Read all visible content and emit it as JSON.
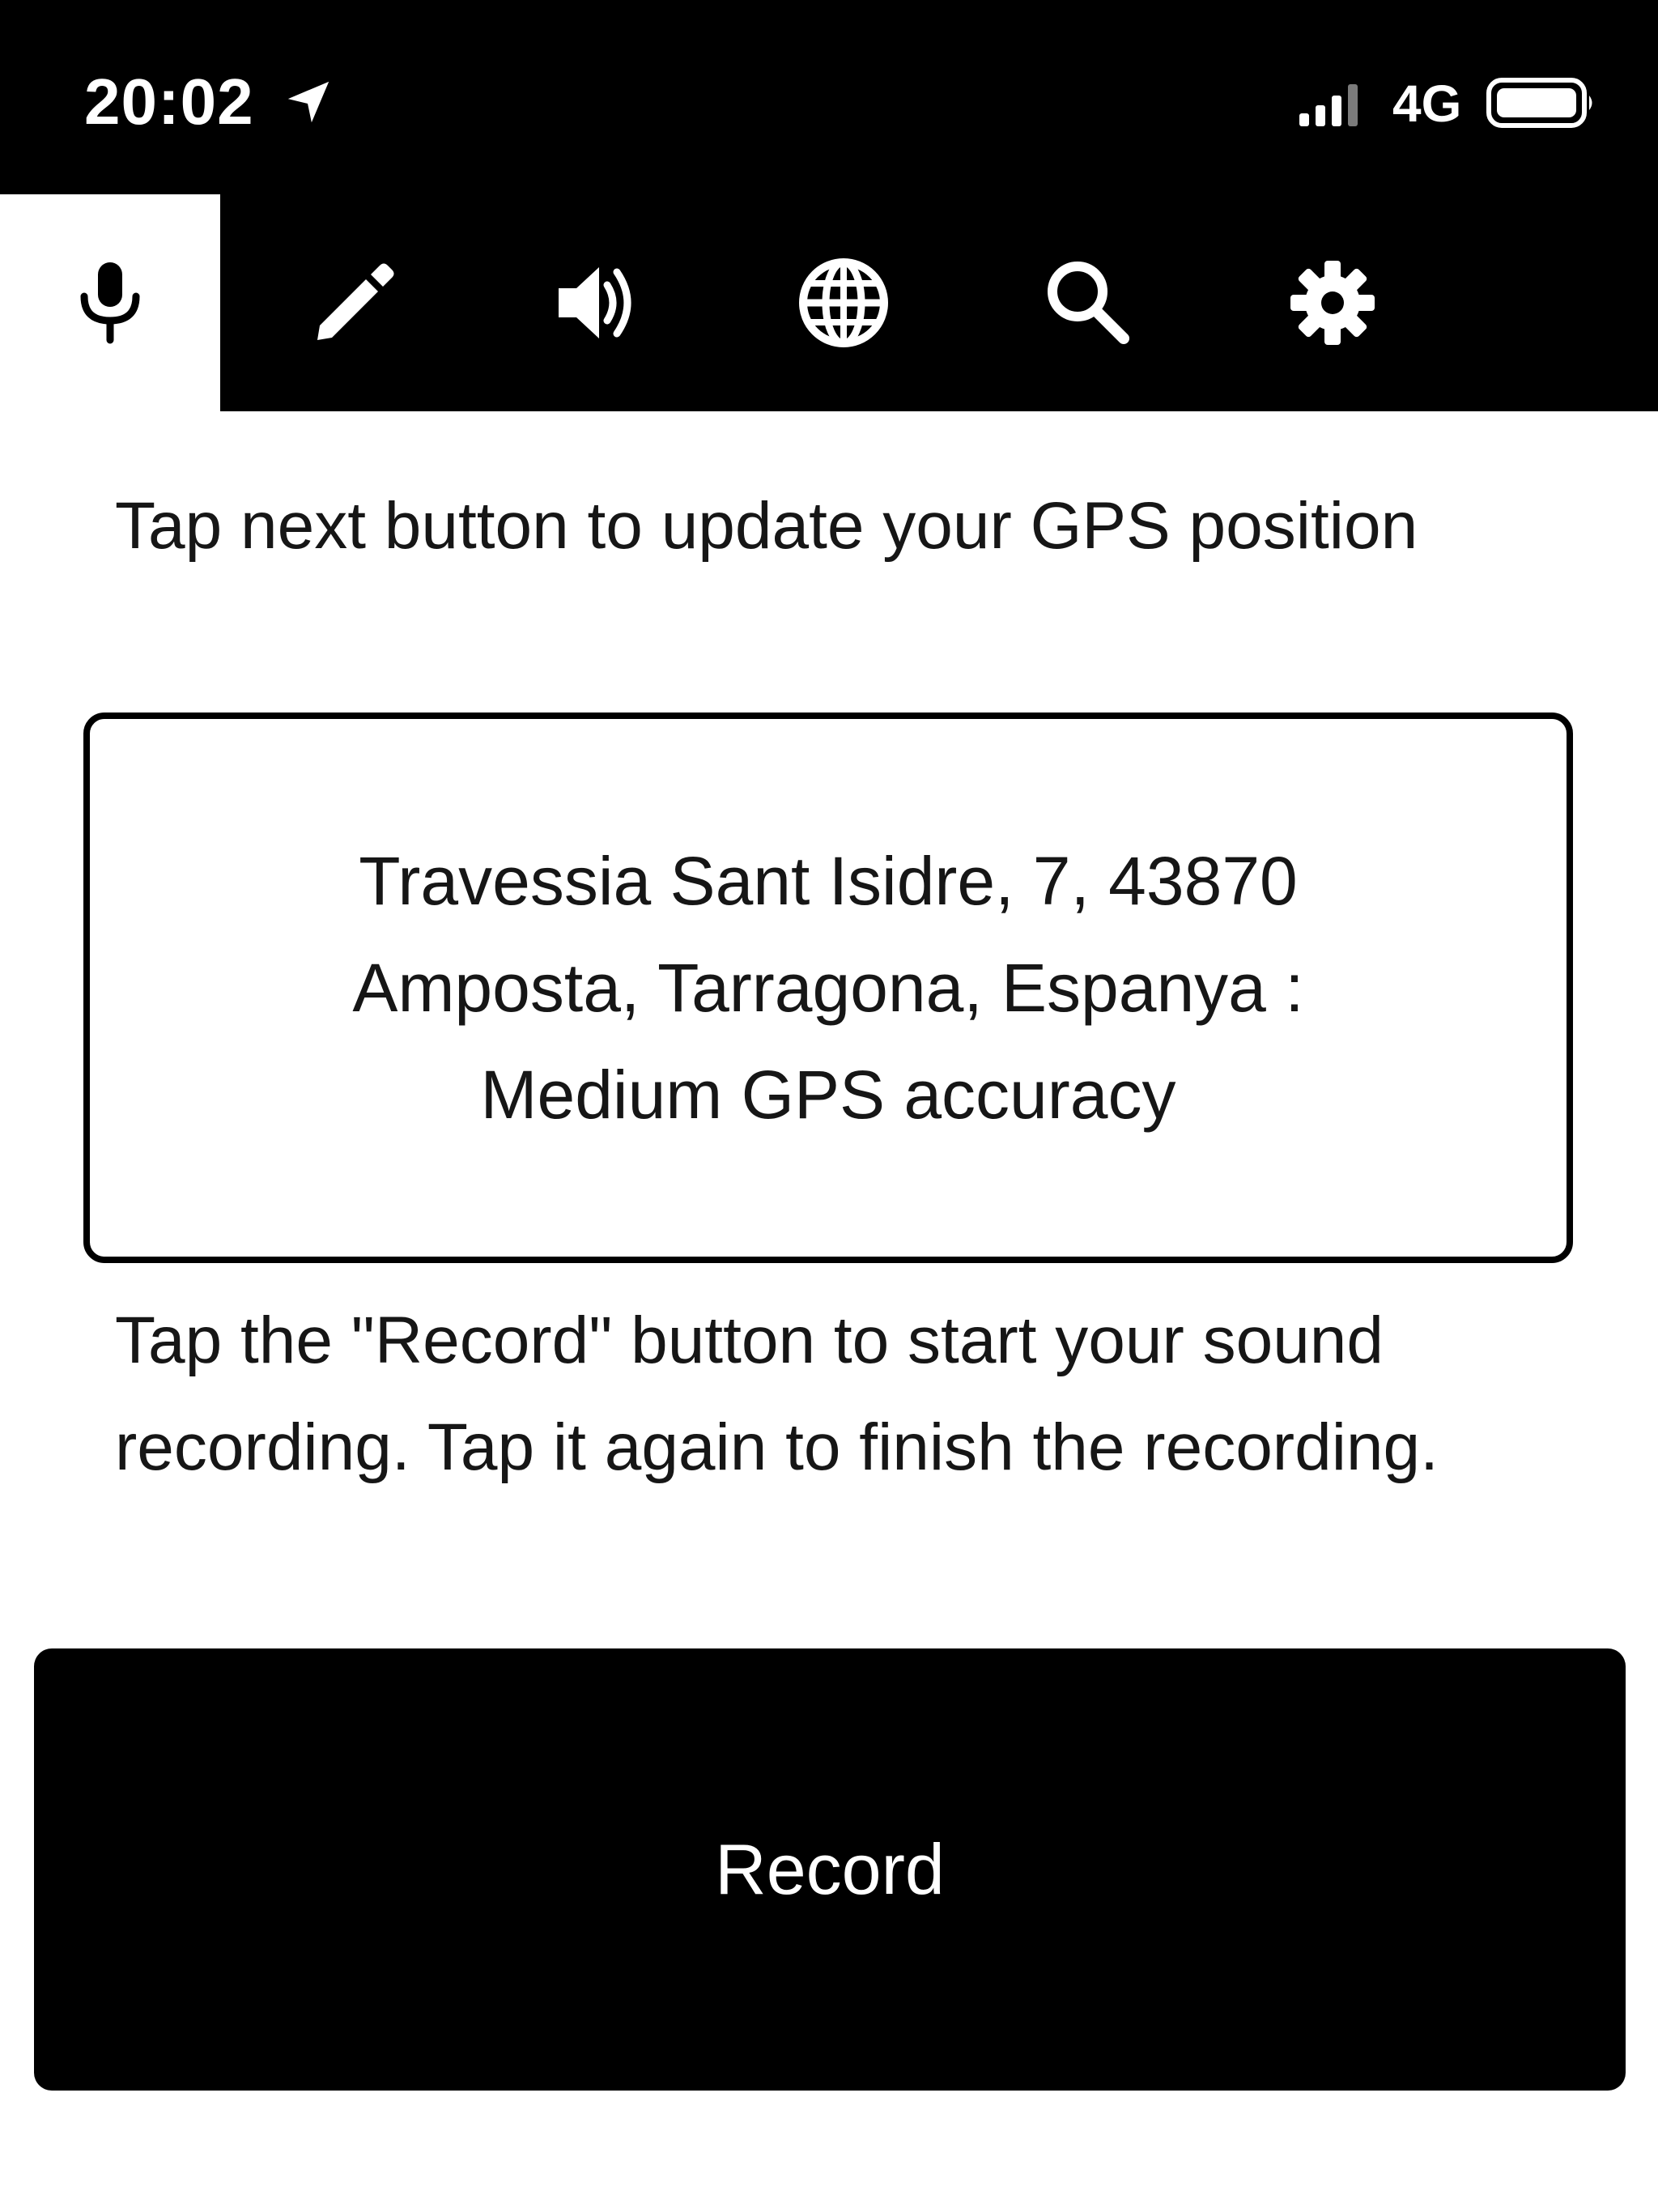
{
  "status_bar": {
    "time": "20:02",
    "network": "4G",
    "location_icon": "location-arrow-icon",
    "signal_icon": "signal-bars-icon",
    "battery_icon": "battery-icon"
  },
  "tabs": [
    {
      "id": "record",
      "icon": "microphone-icon",
      "active": true
    },
    {
      "id": "edit",
      "icon": "pencil-icon",
      "active": false
    },
    {
      "id": "sound",
      "icon": "speaker-icon",
      "active": false
    },
    {
      "id": "web",
      "icon": "globe-icon",
      "active": false
    },
    {
      "id": "search",
      "icon": "search-icon",
      "active": false
    },
    {
      "id": "settings",
      "icon": "gear-icon",
      "active": false
    }
  ],
  "main": {
    "gps_instruction": "Tap next button to update your GPS position",
    "gps_position": "Travessia Sant Isidre, 7, 43870 Amposta, Tarragona, Espanya : Medium GPS accuracy",
    "record_instruction": "Tap the \"Record\" button to start your sound recording. Tap it again to finish the recording.",
    "record_label": "Record"
  },
  "colors": {
    "bar_background": "#000000",
    "page_background": "#ffffff",
    "text": "#161616",
    "button_text": "#ffffff"
  }
}
